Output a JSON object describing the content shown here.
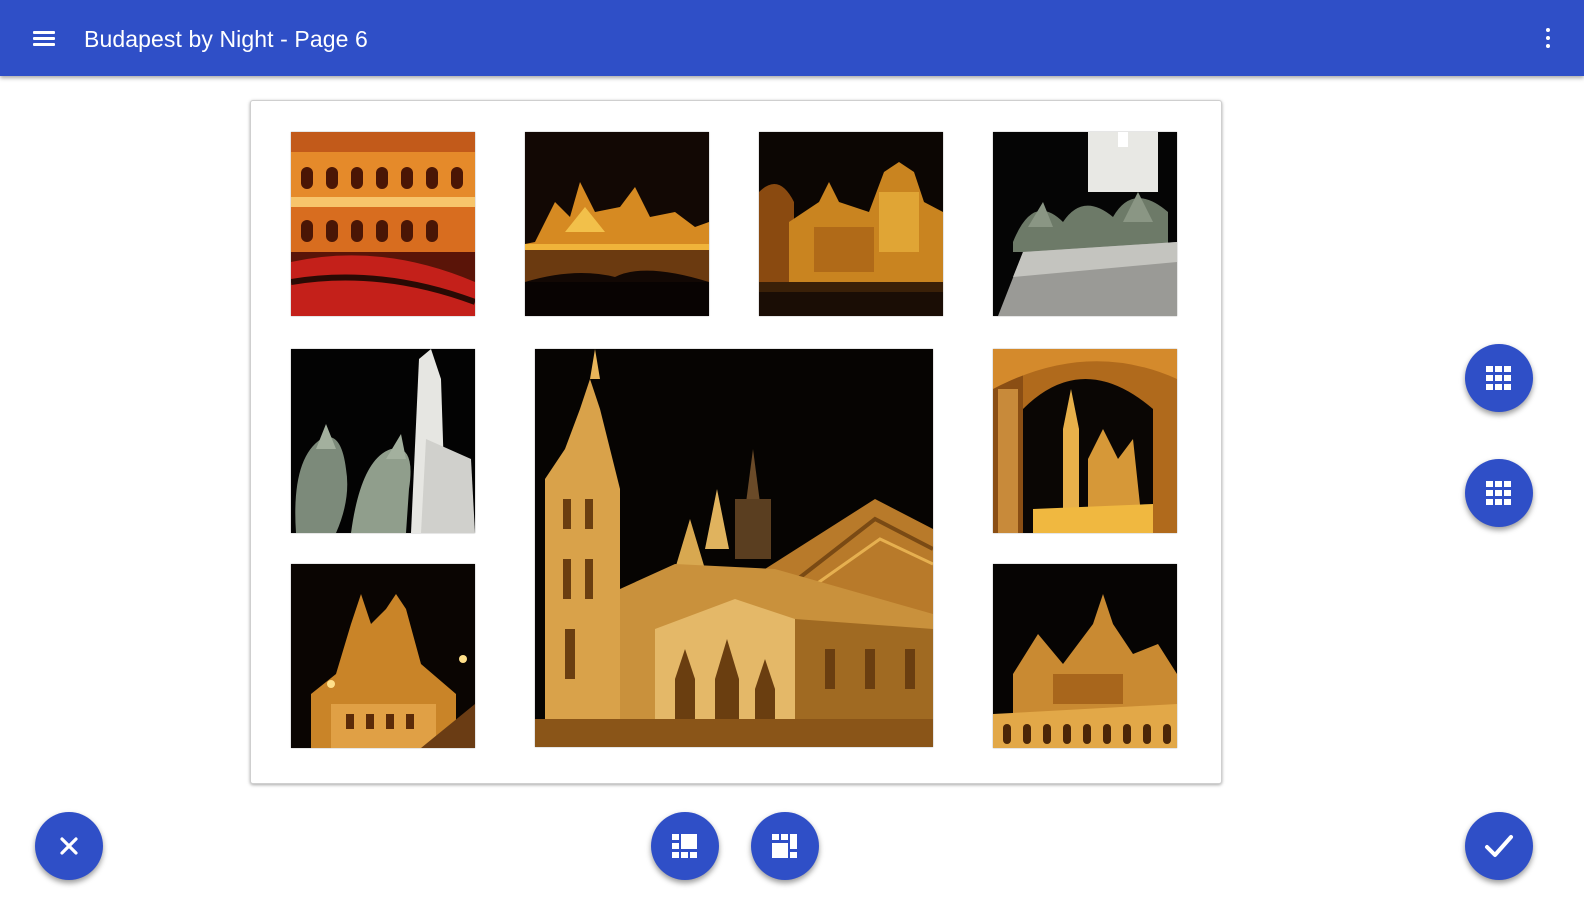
{
  "appbar": {
    "title": "Budapest by Night - Page 6",
    "color": "#2f4fc7",
    "menu_icon": "menu-icon",
    "overflow_icon": "more-vert-icon"
  },
  "collage": {
    "photos": [
      {
        "id": "opera-house-interior",
        "subject": "Opera house interior"
      },
      {
        "id": "vajdahunyad-castle",
        "subject": "Castle reflected in lake at night"
      },
      {
        "id": "parliament-night",
        "subject": "Illuminated building at night"
      },
      {
        "id": "heroes-square-statues",
        "subject": "Equestrian statues on pedestal"
      },
      {
        "id": "heroes-square-horses",
        "subject": "Horse statues against night sky"
      },
      {
        "id": "matthias-church",
        "subject": "Gothic church illuminated at night"
      },
      {
        "id": "church-through-arch",
        "subject": "Church spire through arch"
      },
      {
        "id": "fishermans-bastion",
        "subject": "Bastion towers at night"
      },
      {
        "id": "castle-facade",
        "subject": "Illuminated castle facade"
      }
    ]
  },
  "fabs": {
    "layout_right_1_icon": "grid-layout-icon",
    "layout_right_2_icon": "grid-layout-icon",
    "layout_bottom_1_icon": "grid-layout-icon",
    "layout_bottom_2_icon": "grid-layout-alt-icon",
    "cancel_icon": "close-icon",
    "confirm_icon": "check-icon"
  }
}
